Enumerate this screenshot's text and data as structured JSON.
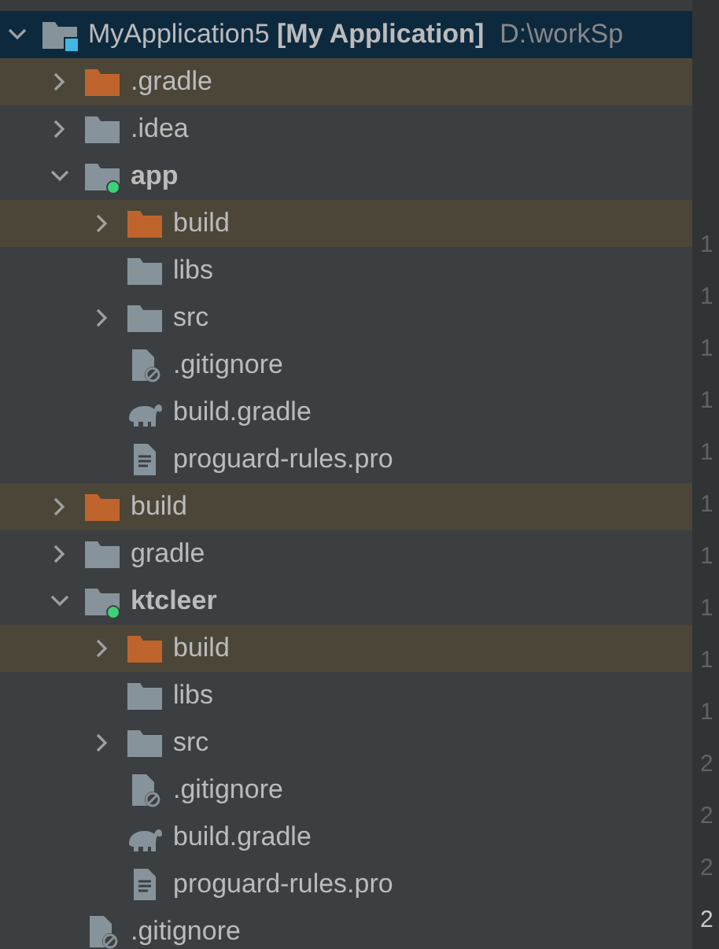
{
  "tree": [
    {
      "label": "MyApplication5 **[My Application]**",
      "path": "D:\\workSp",
      "kind": "project",
      "expanded": true,
      "selected": true,
      "excluded": false,
      "children": [
        {
          "label": ".gradle",
          "kind": "folder",
          "expanded": false,
          "selected": false,
          "excluded": true
        },
        {
          "label": ".idea",
          "kind": "folder",
          "expanded": false,
          "selected": false,
          "excluded": false
        },
        {
          "label": "app",
          "kind": "module",
          "expanded": true,
          "selected": false,
          "excluded": false,
          "children": [
            {
              "label": "build",
              "kind": "folder",
              "expanded": false,
              "selected": false,
              "excluded": true
            },
            {
              "label": "libs",
              "kind": "folder",
              "selected": false,
              "excluded": false
            },
            {
              "label": "src",
              "kind": "folder",
              "expanded": false,
              "selected": false,
              "excluded": false
            },
            {
              "label": ".gitignore",
              "kind": "ignore-file",
              "selected": false
            },
            {
              "label": "build.gradle",
              "kind": "gradle-file",
              "selected": false
            },
            {
              "label": "proguard-rules.pro",
              "kind": "text-file",
              "selected": false
            }
          ]
        },
        {
          "label": "build",
          "kind": "folder",
          "expanded": false,
          "selected": false,
          "excluded": true
        },
        {
          "label": "gradle",
          "kind": "folder",
          "expanded": false,
          "selected": false,
          "excluded": false
        },
        {
          "label": "ktcleer",
          "kind": "module",
          "expanded": true,
          "selected": false,
          "excluded": false,
          "children": [
            {
              "label": "build",
              "kind": "folder",
              "expanded": false,
              "selected": false,
              "excluded": true
            },
            {
              "label": "libs",
              "kind": "folder",
              "selected": false,
              "excluded": false
            },
            {
              "label": "src",
              "kind": "folder",
              "expanded": false,
              "selected": false,
              "excluded": false
            },
            {
              "label": ".gitignore",
              "kind": "ignore-file",
              "selected": false
            },
            {
              "label": "build.gradle",
              "kind": "gradle-file",
              "selected": false
            },
            {
              "label": "proguard-rules.pro",
              "kind": "text-file",
              "selected": false
            }
          ]
        },
        {
          "label": ".gitignore",
          "kind": "ignore-file",
          "selected": false
        }
      ]
    }
  ],
  "gutter": [
    {
      "text": "1",
      "current": false
    },
    {
      "text": "1",
      "current": false
    },
    {
      "text": "1",
      "current": false
    },
    {
      "text": "1",
      "current": false
    },
    {
      "text": "1",
      "current": false
    },
    {
      "text": "1",
      "current": false
    },
    {
      "text": "1",
      "current": false
    },
    {
      "text": "1",
      "current": false
    },
    {
      "text": "1",
      "current": false
    },
    {
      "text": "1",
      "current": false
    },
    {
      "text": "2",
      "current": false
    },
    {
      "text": "2",
      "current": false
    },
    {
      "text": "2",
      "current": false
    },
    {
      "text": "2",
      "current": true
    }
  ]
}
